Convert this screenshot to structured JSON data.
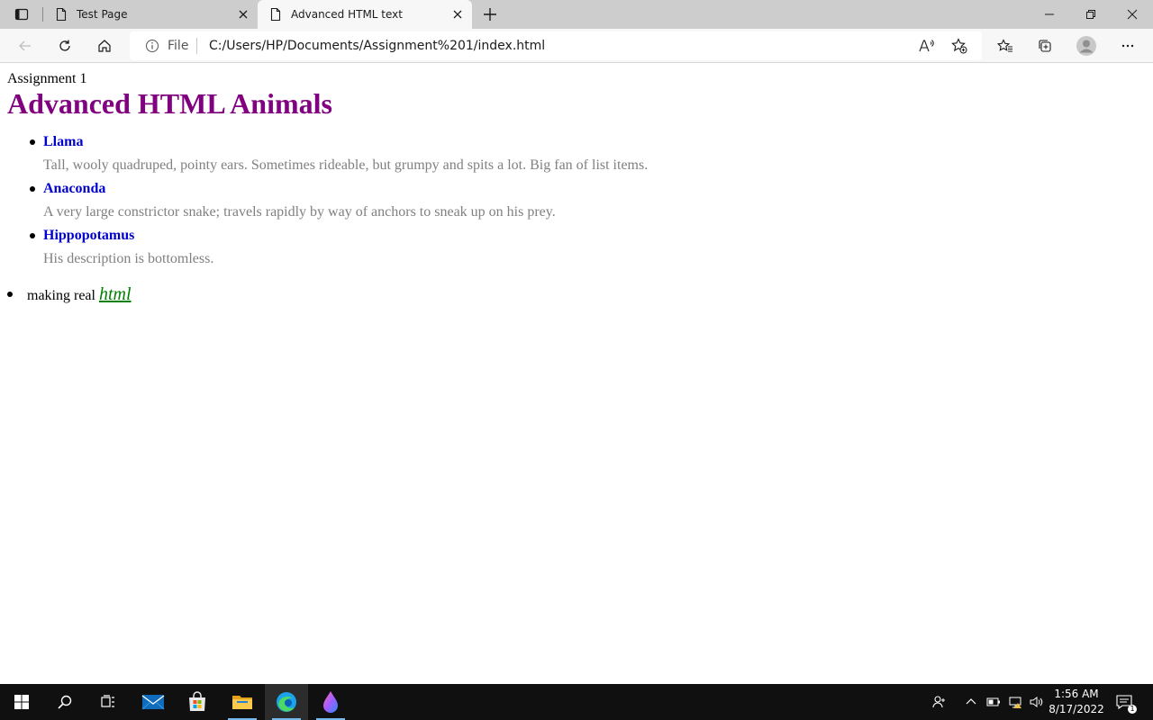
{
  "browser": {
    "tabs": [
      {
        "title": "Test Page",
        "active": false
      },
      {
        "title": "Advanced HTML text",
        "active": true
      }
    ],
    "address": {
      "scheme": "File",
      "url": "C:/Users/HP/Documents/Assignment%201/index.html"
    }
  },
  "page": {
    "header": "Assignment 1",
    "title": "Advanced HTML Animals",
    "title_color": "#800080",
    "animals": [
      {
        "name": "Llama",
        "description": "Tall, wooly quadruped, pointy ears. Sometimes rideable, but grumpy and spits a lot. Big fan of list items."
      },
      {
        "name": "Anaconda",
        "description": "A very large constrictor snake; travels rapidly by way of anchors to sneak up on his prey."
      },
      {
        "name": "Hippopotamus",
        "description": "His description is bottomless."
      }
    ],
    "animal_name_color": "#0000cd",
    "description_color": "#808080",
    "extra": {
      "text": "making real",
      "emphasis": "html",
      "emphasis_color": "#008000"
    }
  },
  "taskbar": {
    "apps": [
      "start-icon",
      "search-icon",
      "task-view-icon",
      "mail-icon",
      "store-icon",
      "file-explorer-icon",
      "edge-icon",
      "paint-icon"
    ],
    "clock": {
      "time": "1:56 AM",
      "date": "8/17/2022"
    },
    "notifications": "1"
  }
}
